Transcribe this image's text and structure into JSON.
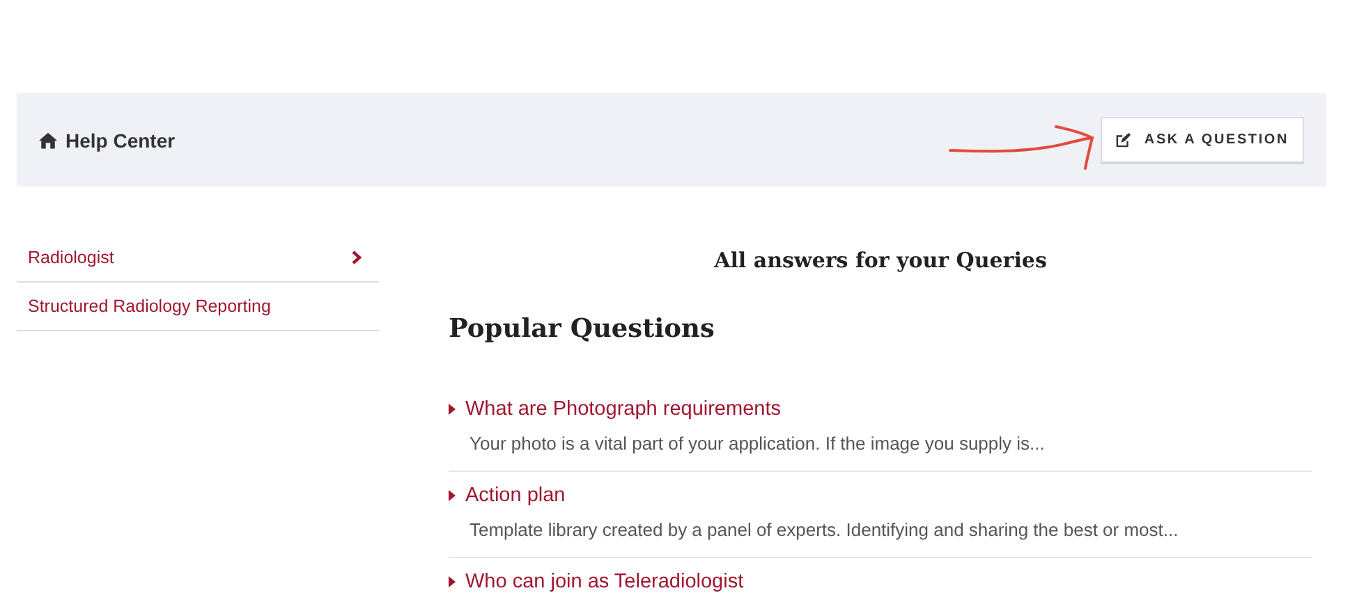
{
  "header": {
    "title": "Help Center",
    "button": "ASK A QUESTION"
  },
  "sidebar": {
    "items": [
      {
        "label": "Radiologist",
        "has_arrow": true
      },
      {
        "label": "Structured Radiology Reporting",
        "has_arrow": false
      }
    ]
  },
  "main": {
    "title": "All answers for your Queries",
    "section_title": "Popular Questions",
    "questions": [
      {
        "title": "What are Photograph requirements",
        "summary": "Your photo is a vital part of your application. If the image you supply is..."
      },
      {
        "title": "Action plan",
        "summary": "Template library created by a panel of experts. Identifying and sharing the best or most..."
      },
      {
        "title": "Who can join as Teleradiologist"
      }
    ]
  }
}
